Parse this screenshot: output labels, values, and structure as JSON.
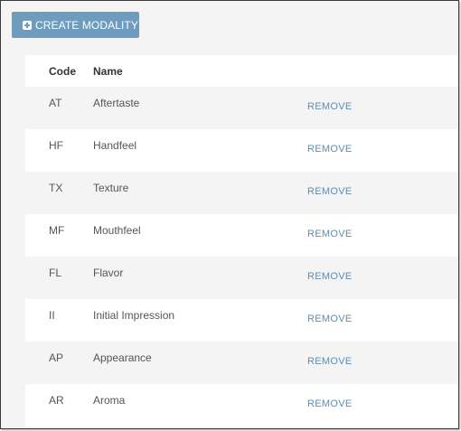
{
  "toolbar": {
    "create_label": "CREATE MODALITY",
    "create_icon": "plus-square-icon"
  },
  "table": {
    "columns": [
      "Code",
      "Name"
    ],
    "remove_label": "REMOVE",
    "rows": [
      {
        "code": "AT",
        "name": "Aftertaste"
      },
      {
        "code": "HF",
        "name": "Handfeel"
      },
      {
        "code": "TX",
        "name": "Texture"
      },
      {
        "code": "MF",
        "name": "Mouthfeel"
      },
      {
        "code": "FL",
        "name": "Flavor"
      },
      {
        "code": "II",
        "name": "Initial Impression"
      },
      {
        "code": "AP",
        "name": "Appearance"
      },
      {
        "code": "AR",
        "name": "Aroma"
      }
    ]
  },
  "colors": {
    "button_bg": "#6e9cbf",
    "link": "#5a8fb4",
    "row_alt": "#f4f4f4"
  }
}
